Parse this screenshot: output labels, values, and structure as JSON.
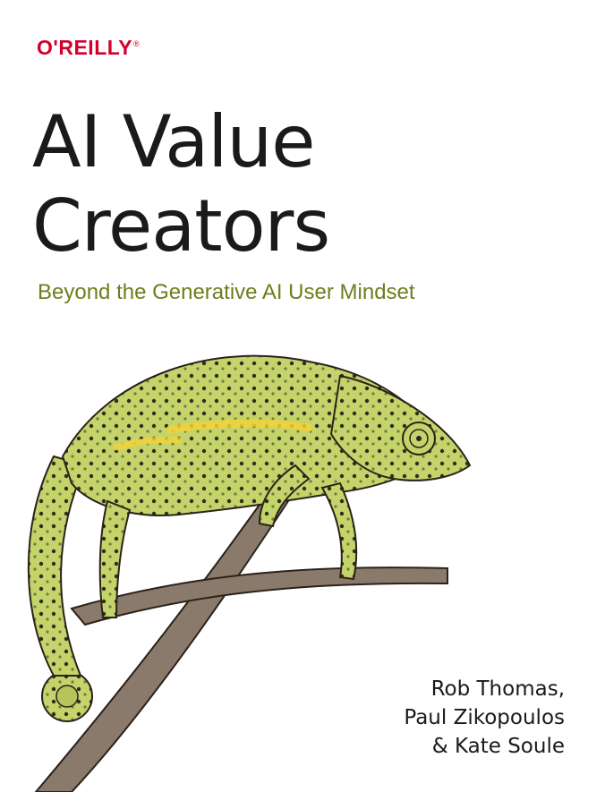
{
  "publisher": {
    "name": "O'REILLY",
    "mark": "®"
  },
  "book": {
    "title_line1": "AI Value",
    "title_line2": "Creators",
    "subtitle": "Beyond the Generative AI User Mindset"
  },
  "authors": [
    "Rob Thomas,",
    "Paul Zikopoulos",
    "& Kate Soule"
  ],
  "illustration": {
    "subject": "chameleon-on-branch"
  },
  "colors": {
    "brand_red": "#d3002d",
    "subtitle_green": "#6b7f1d",
    "chameleon_green": "#c4d36a",
    "chameleon_yellow": "#f0d23a",
    "branch_brown": "#8a7a6b"
  }
}
